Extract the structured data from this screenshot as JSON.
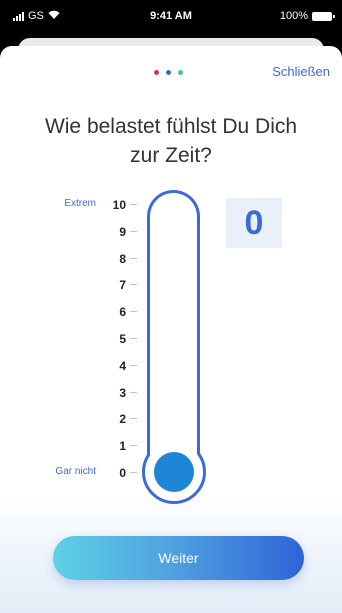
{
  "status_bar": {
    "carrier": "GS",
    "time": "9:41 AM",
    "battery": "100%"
  },
  "modal": {
    "close_label": "Schließen",
    "question_line1": "Wie belastet fühlst Du Dich",
    "question_line2": "zur Zeit?",
    "pagination_colors": [
      "#d1364e",
      "#3b6bd6",
      "#35c6b0"
    ],
    "value": "0",
    "next_label": "Weiter"
  },
  "scale": {
    "top_label": "Extrem",
    "bottom_label": "Gar nicht",
    "levels": [
      "10",
      "9",
      "8",
      "7",
      "6",
      "5",
      "4",
      "3",
      "2",
      "1",
      "0"
    ],
    "current_level_fraction": 0
  },
  "colors": {
    "accent": "#3b6bd6",
    "thermometer_fill": "#1f86d6"
  }
}
